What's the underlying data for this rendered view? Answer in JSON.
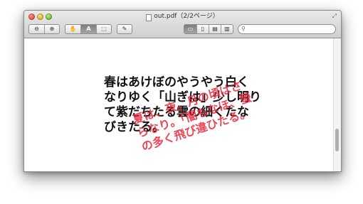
{
  "window": {
    "title": "out.pdf（2/2ページ）"
  },
  "toolbar": {
    "zoom_out_icon": "zoom-out-icon",
    "zoom_in_icon": "zoom-in-icon",
    "hand_icon": "hand-icon",
    "text_select_label": "A",
    "select_icon": "select-icon",
    "annotate_icon": "pencil-icon",
    "view_modes": [
      "single-page-icon",
      "two-page-icon",
      "continuous-icon",
      "sidebar-icon"
    ]
  },
  "search": {
    "placeholder": "",
    "value": ""
  },
  "page": {
    "lines": [
      "春はあけぼのやうやう白く",
      "なりゆく「山ぎは」少し明り",
      "て紫だちたる雲の細くたな",
      "びきたる。"
    ],
    "overlay_lines": [
      "夏は、夜。月の頃はさ",
      "らなり。「闇もなほ、螢",
      "の多く飛び違ひたる。"
    ]
  },
  "colors": {
    "overlay_text": "#e8283c",
    "titlebar_top": "#e9e9e9",
    "titlebar_bottom": "#cfcfcf"
  }
}
